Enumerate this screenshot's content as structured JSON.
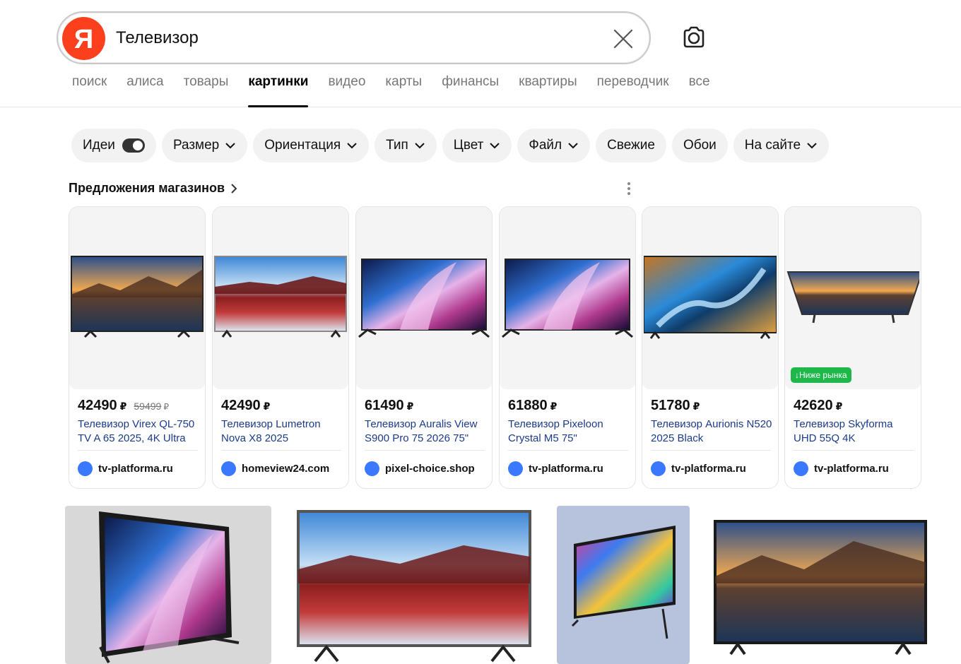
{
  "search": {
    "query": "Телевизор",
    "logo_letter": "Я"
  },
  "nav": [
    {
      "label": "поиск",
      "active": false
    },
    {
      "label": "алиса",
      "active": false
    },
    {
      "label": "товары",
      "active": false
    },
    {
      "label": "картинки",
      "active": true
    },
    {
      "label": "видео",
      "active": false
    },
    {
      "label": "карты",
      "active": false
    },
    {
      "label": "финансы",
      "active": false
    },
    {
      "label": "квартиры",
      "active": false
    },
    {
      "label": "переводчик",
      "active": false
    },
    {
      "label": "все",
      "active": false
    }
  ],
  "filters": {
    "ideas": "Идеи",
    "size": "Размер",
    "orientation": "Ориентация",
    "type": "Тип",
    "color": "Цвет",
    "file": "Файл",
    "fresh": "Свежие",
    "wallpapers": "Обои",
    "on_site": "На сайте"
  },
  "offers": {
    "title": "Предложения магазинов",
    "currency": "₽",
    "items": [
      {
        "price": "42490",
        "old_price": "59499",
        "title": "Телевизор Virex QL-750 TV A 65 2025, 4K Ultra",
        "shop": "tv-platforma.ru"
      },
      {
        "price": "42490",
        "title": "Телевизор Lumetron Nova X8 2025",
        "shop": "homeview24.com"
      },
      {
        "price": "61490",
        "title": "Телевизор Auralis View S900 Pro 75 2026 75\"",
        "shop": "pixel-choice.shop"
      },
      {
        "price": "61880",
        "title": "Телевизор Pixeloon Crystal M5 75\"",
        "shop": "tv-platforma.ru"
      },
      {
        "price": "51780",
        "title": "Телевизор Aurionis N520 2025 Black",
        "shop": "tv-platforma.ru"
      },
      {
        "price": "42620",
        "title": "Телевизор Skyforma UHD 55Q 4K",
        "shop": "tv-platforma.ru",
        "badge": "↓Ниже рынка"
      }
    ]
  },
  "colors": {
    "brand_red": "#fc3f1d",
    "badge_green": "#1eb84a",
    "link_blue": "#1a3a8a",
    "shop_dot": "#3a78ff"
  }
}
